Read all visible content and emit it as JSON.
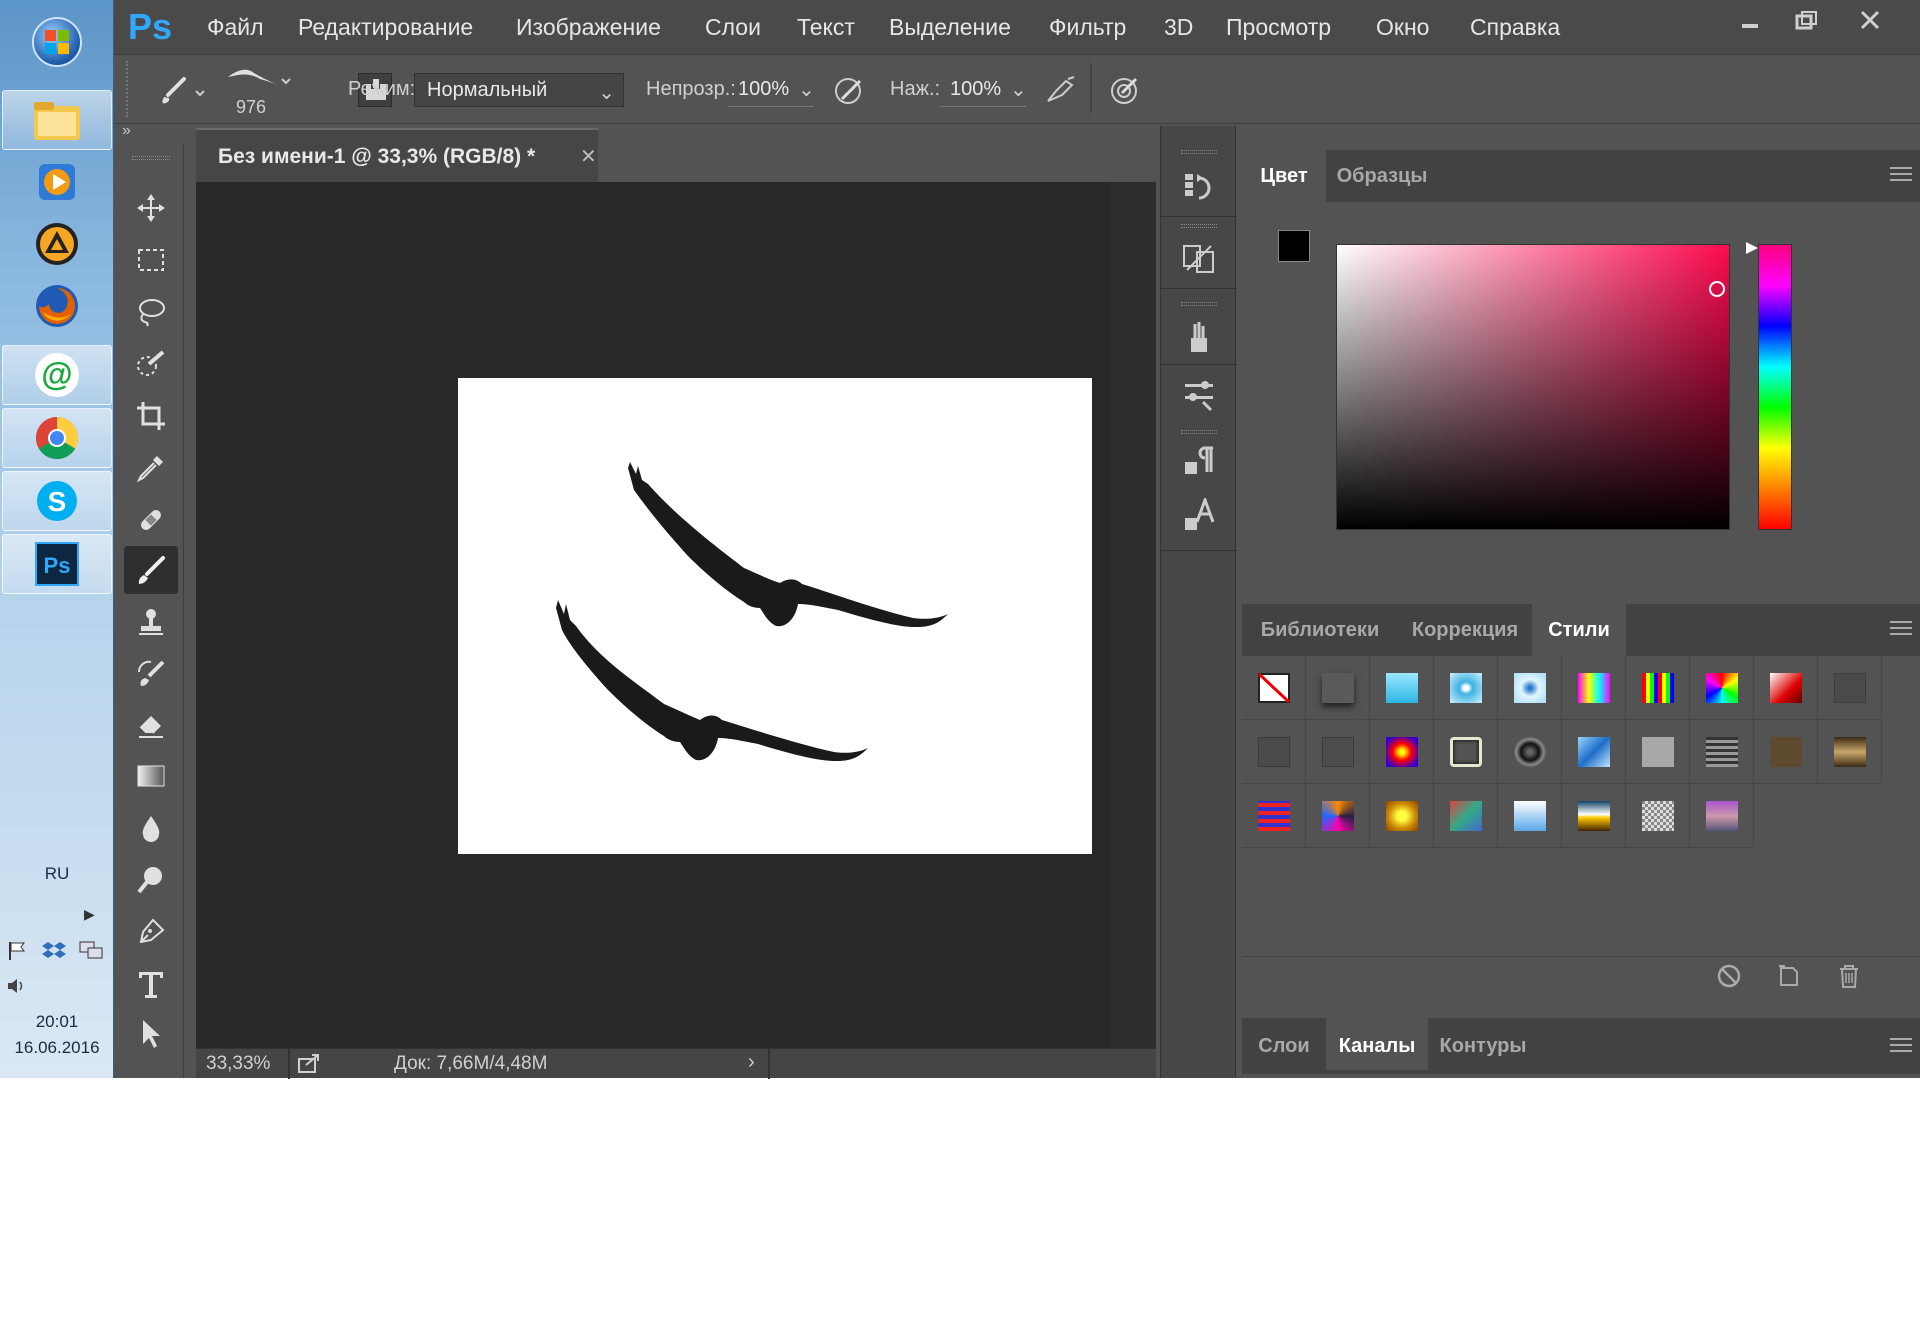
{
  "taskbar": {
    "apps": [
      {
        "name": "windows-start",
        "color": "#3b7bd0"
      },
      {
        "name": "file-explorer",
        "color": "#e8b84a"
      },
      {
        "name": "media-player",
        "color": "#f08a1c"
      },
      {
        "name": "aimp",
        "color": "#f5a623"
      },
      {
        "name": "firefox",
        "color": "#e66000"
      },
      {
        "name": "mail-agent",
        "color": "#2bb34a"
      },
      {
        "name": "chrome",
        "color": "#dd4b39"
      },
      {
        "name": "skype",
        "color": "#00aff0"
      },
      {
        "name": "photoshop",
        "color": "#0d2740"
      }
    ],
    "language": "RU",
    "time": "20:01",
    "date": "16.06.2016"
  },
  "app": {
    "logo": "Ps",
    "menu": [
      "Файл",
      "Редактирование",
      "Изображение",
      "Слои",
      "Текст",
      "Выделение",
      "Фильтр",
      "3D",
      "Просмотр",
      "Окно",
      "Справка"
    ]
  },
  "options": {
    "brush_size": "976",
    "mode_label": "Режим:",
    "mode_value": "Нормальный",
    "opacity_label": "Непрозр.:",
    "opacity_value": "100%",
    "flow_label": "Наж.:",
    "flow_value": "100%"
  },
  "document": {
    "tab_title": "Без имени-1 @ 33,3% (RGB/8) *",
    "zoom": "33,33%",
    "doc_info": "Док: 7,66M/4,48M",
    "canvas_color": "#ffffff"
  },
  "color_panel": {
    "tabs": [
      "Цвет",
      "Образцы"
    ],
    "foreground": "#000000",
    "background": "#e0103c",
    "hue_color": "#ff0a50"
  },
  "styles_panel": {
    "tabs": [
      "Библиотеки",
      "Коррекция",
      "Стили"
    ],
    "active_tab": "Стили"
  },
  "bottom_panel": {
    "tabs": [
      "Слои",
      "Каналы",
      "Контуры"
    ],
    "active_tab": "Каналы"
  }
}
